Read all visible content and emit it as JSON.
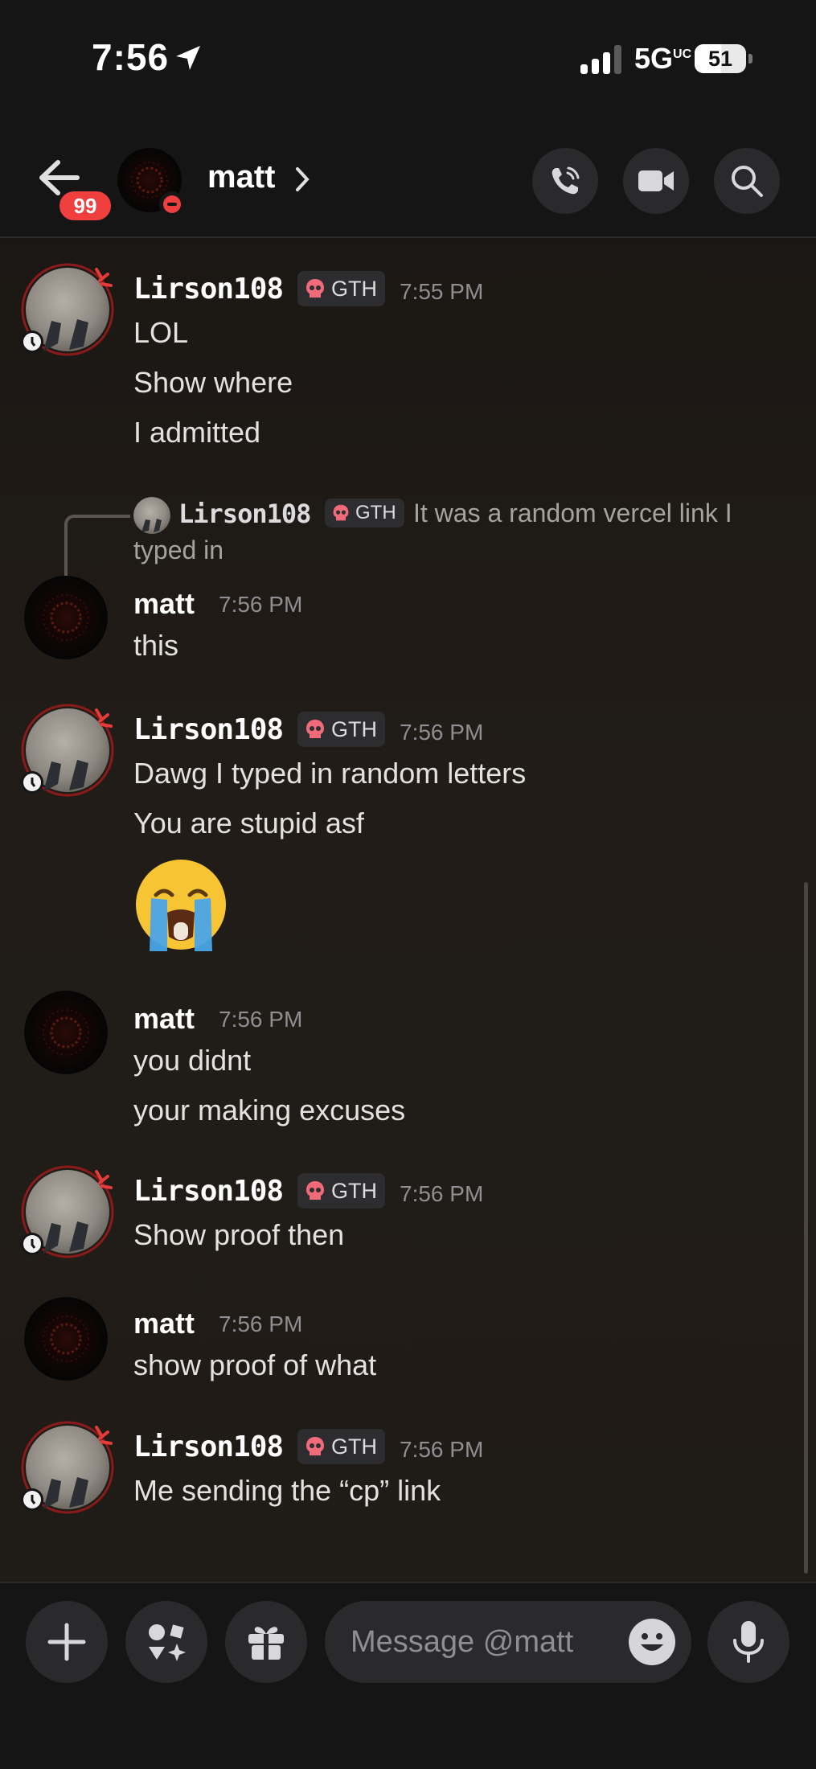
{
  "status_bar": {
    "time": "7:56",
    "network": "5G",
    "network_sup": "UC",
    "battery": "51"
  },
  "header": {
    "unread_badge": "99",
    "contact_name": "matt",
    "icons": [
      "back-arrow-icon",
      "phone-call-icon",
      "video-camera-icon",
      "search-icon"
    ]
  },
  "messages": [
    {
      "author": "Lirson108",
      "tag": "GTH",
      "time": "7:55 PM",
      "lines": [
        "LOL",
        "Show where",
        "I admitted"
      ]
    },
    {
      "reply_to": {
        "author": "Lirson108",
        "tag": "GTH",
        "text_line1": "It was a random vercel link I",
        "text_line2": "typed in"
      },
      "author": "matt",
      "time": "7:56 PM",
      "lines": [
        "this"
      ]
    },
    {
      "author": "Lirson108",
      "tag": "GTH",
      "time": "7:56 PM",
      "lines": [
        "Dawg I typed in random letters",
        "You are stupid asf"
      ],
      "emoji": "loudly-crying-face"
    },
    {
      "author": "matt",
      "time": "7:56 PM",
      "lines": [
        "you didnt",
        "your making excuses"
      ]
    },
    {
      "author": "Lirson108",
      "tag": "GTH",
      "time": "7:56 PM",
      "lines": [
        "Show proof then"
      ]
    },
    {
      "author": "matt",
      "time": "7:56 PM",
      "lines": [
        "show proof of what"
      ]
    },
    {
      "author": "Lirson108",
      "tag": "GTH",
      "time": "7:56 PM",
      "lines": [
        "Me sending the “cp” link"
      ]
    }
  ],
  "composer": {
    "placeholder": "Message @matt",
    "icons": [
      "plus-icon",
      "apps-icon",
      "gift-icon",
      "emoji-icon",
      "microphone-icon"
    ]
  },
  "colors": {
    "background": "#151515",
    "chat_bg": "#1f1b17",
    "badge_red": "#ef3f3f",
    "muted_text": "#8e8e93"
  }
}
